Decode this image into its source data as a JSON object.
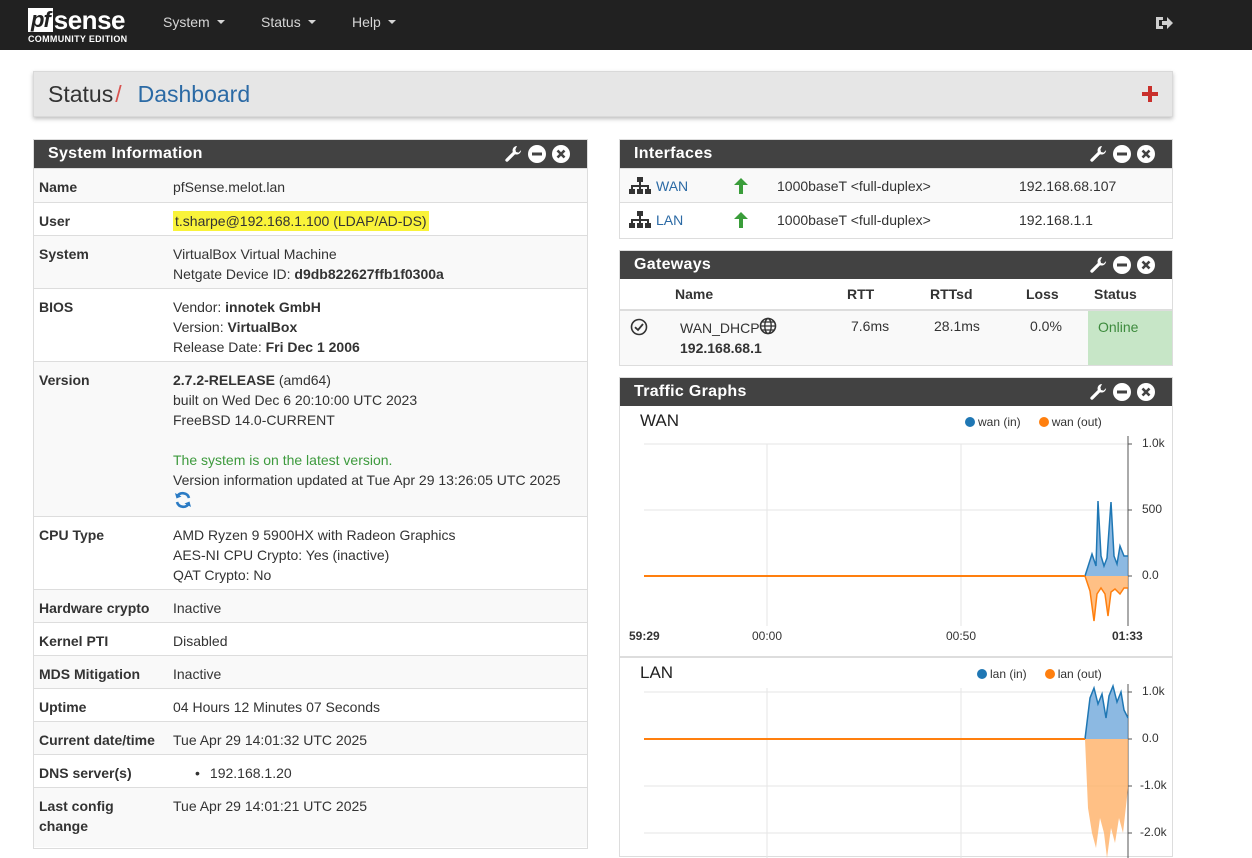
{
  "nav": {
    "brand_pf": "pf",
    "brand_sense": "sense",
    "brand_sub": "COMMUNITY EDITION",
    "menu": [
      "System",
      "Status",
      "Help"
    ]
  },
  "breadcrumb": {
    "parent": "Status",
    "separator": "/",
    "current": "Dashboard"
  },
  "system_info": {
    "title": "System Information",
    "rows": [
      {
        "label": "Name",
        "lines": [
          "pfSense.melot.lan"
        ]
      },
      {
        "label": "User",
        "lines": [
          "t.sharpe@192.168.1.100 (LDAP/AD-DS)"
        ]
      },
      {
        "label": "System",
        "lines": [
          "VirtualBox Virtual Machine"
        ],
        "device_id_label": "Netgate Device ID: ",
        "device_id": "d9db822627ffb1f0300a"
      },
      {
        "label": "BIOS",
        "vendor_label": "Vendor: ",
        "vendor": "innotek GmbH",
        "version_label": "Version: ",
        "version": "VirtualBox",
        "release_label": "Release Date: ",
        "release": "Fri Dec 1 2006"
      },
      {
        "label": "Version",
        "release": "2.7.2-RELEASE",
        "arch": " (amd64)",
        "built": "built on Wed Dec 6 20:10:00 UTC 2023",
        "os": "FreeBSD 14.0-CURRENT",
        "status": "The system is on the latest version.",
        "updated": "Version information updated at Tue Apr 29 13:26:05 UTC 2025"
      },
      {
        "label": "CPU Type",
        "lines": [
          "AMD Ryzen 9 5900HX with Radeon Graphics",
          "AES-NI CPU Crypto: Yes (inactive)",
          "QAT Crypto: No"
        ]
      },
      {
        "label": "Hardware crypto",
        "lines": [
          "Inactive"
        ]
      },
      {
        "label": "Kernel PTI",
        "lines": [
          "Disabled"
        ]
      },
      {
        "label": "MDS Mitigation",
        "lines": [
          "Inactive"
        ]
      },
      {
        "label": "Uptime",
        "lines": [
          "04 Hours 12 Minutes 07 Seconds"
        ]
      },
      {
        "label": "Current date/time",
        "lines": [
          "Tue Apr 29 14:01:32 UTC 2025"
        ]
      },
      {
        "label": "DNS server(s)",
        "lines": [
          "192.168.1.20"
        ]
      },
      {
        "label_line1": "Last config",
        "label_line2": "change",
        "lines": [
          "Tue Apr 29 14:01:21 UTC 2025"
        ]
      }
    ]
  },
  "interfaces": {
    "title": "Interfaces",
    "rows": [
      {
        "name": "WAN",
        "media": "1000baseT <full-duplex>",
        "ip": "192.168.68.107",
        "status": "up"
      },
      {
        "name": "LAN",
        "media": "1000baseT <full-duplex>",
        "ip": "192.168.1.1",
        "status": "up"
      }
    ]
  },
  "gateways": {
    "title": "Gateways",
    "headers": {
      "name": "Name",
      "rtt": "RTT",
      "rttsd": "RTTsd",
      "loss": "Loss",
      "status": "Status"
    },
    "rows": [
      {
        "name": "WAN_DHCP",
        "ip": "192.168.68.1",
        "rtt": "7.6ms",
        "rttsd": "28.1ms",
        "loss": "0.0%",
        "status": "Online"
      }
    ]
  },
  "traffic": {
    "title": "Traffic Graphs",
    "colors": {
      "in": "#1f77b4",
      "out": "#ff7f0e"
    },
    "wan": {
      "name": "WAN",
      "legend_in": "wan (in)",
      "legend_out": "wan (out)",
      "y_ticks": [
        "1.0k",
        "500",
        "0.0"
      ],
      "x_ticks": [
        "59:29",
        "00:00",
        "00:50",
        "01:33"
      ]
    },
    "lan": {
      "name": "LAN",
      "legend_in": "lan (in)",
      "legend_out": "lan (out)",
      "y_ticks": [
        "1.0k",
        "0.0",
        "-1.0k",
        "-2.0k"
      ]
    }
  }
}
